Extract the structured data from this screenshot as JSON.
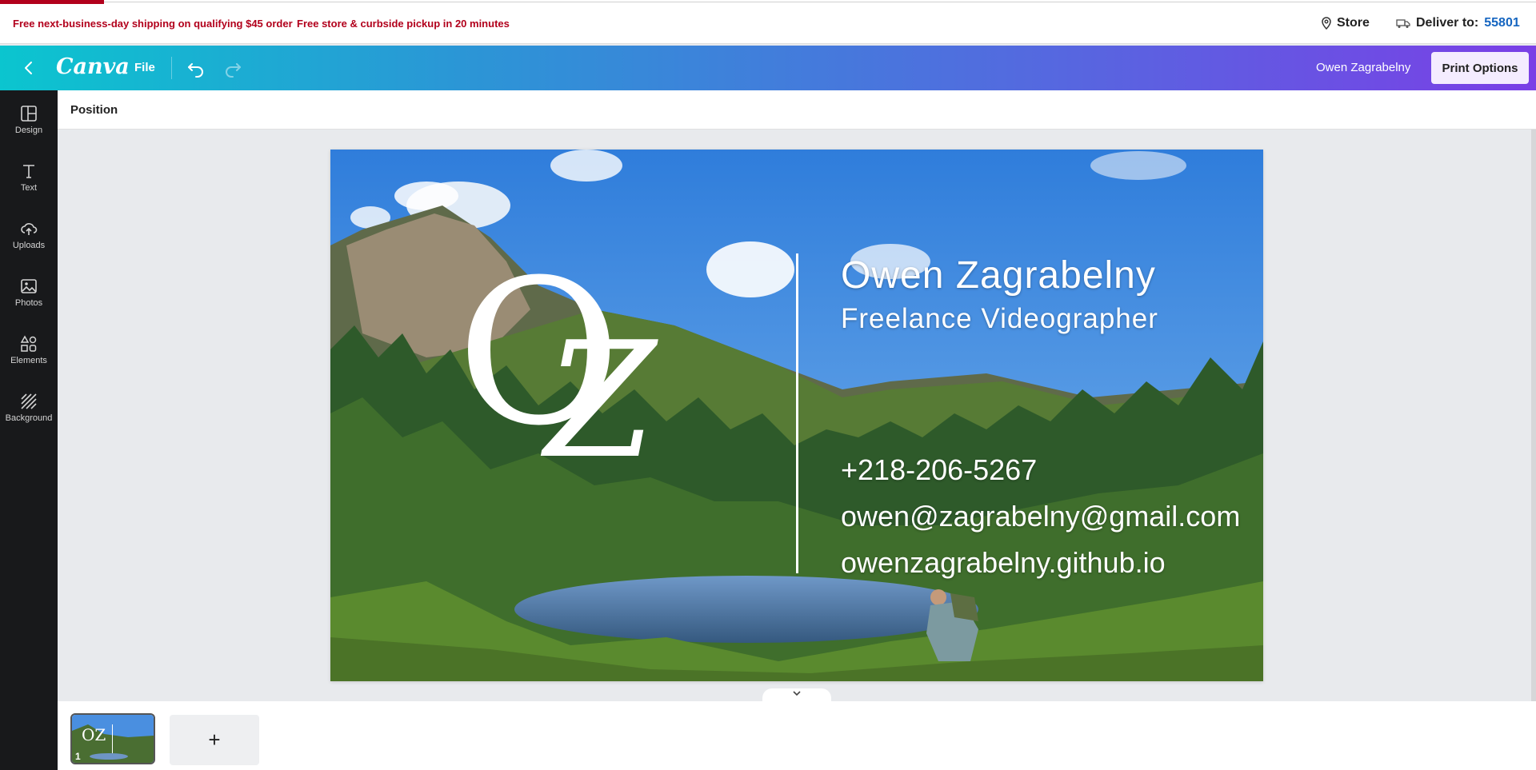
{
  "promo": {
    "shipping": "Free next-business-day shipping on qualifying $45 order",
    "pickup": "Free store & curbside pickup in 20 minutes",
    "store_label": "Store",
    "deliver_label": "Deliver to:",
    "zip": "55801"
  },
  "header": {
    "logo": "Canva",
    "file_label": "File",
    "user_name": "Owen Zagrabelny",
    "print_label": "Print Options"
  },
  "sidebar": {
    "items": [
      {
        "label": "Design",
        "icon": "layout-icon"
      },
      {
        "label": "Text",
        "icon": "text-icon"
      },
      {
        "label": "Uploads",
        "icon": "upload-cloud-icon"
      },
      {
        "label": "Photos",
        "icon": "image-icon"
      },
      {
        "label": "Elements",
        "icon": "shapes-icon"
      },
      {
        "label": "Background",
        "icon": "hatch-icon"
      }
    ]
  },
  "toolbar": {
    "position_label": "Position"
  },
  "card": {
    "monogram_o": "O",
    "monogram_z": "Z",
    "name": "Owen Zagrabelny",
    "title": "Freelance Videographer",
    "phone": "+218-206-5267",
    "email": "owen@zagrabelny@gmail.com",
    "website": "owenzagrabelny.github.io"
  },
  "pages": {
    "current_page_number": "1",
    "add_label": "+"
  },
  "colors": {
    "promo_red": "#b2001c",
    "zip_blue": "#1565c0",
    "gradient_start": "#0bc5cf",
    "gradient_end": "#7a3fe6"
  }
}
